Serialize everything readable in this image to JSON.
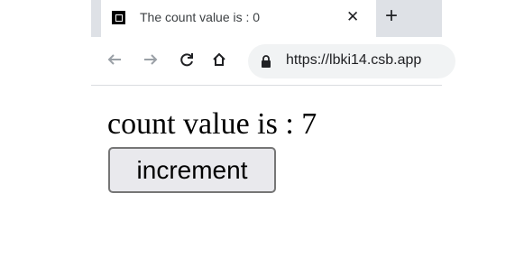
{
  "browser": {
    "tab_title": "The count value is : 0",
    "tab_close": "✕",
    "new_tab": "+",
    "url": "https://lbki14.csb.app",
    "icons": [
      "back-icon",
      "forward-icon",
      "reload-icon",
      "home-icon",
      "lock-icon",
      "favicon-icon"
    ]
  },
  "app": {
    "count_text": "count value is : 7",
    "increment_label": "increment"
  }
}
